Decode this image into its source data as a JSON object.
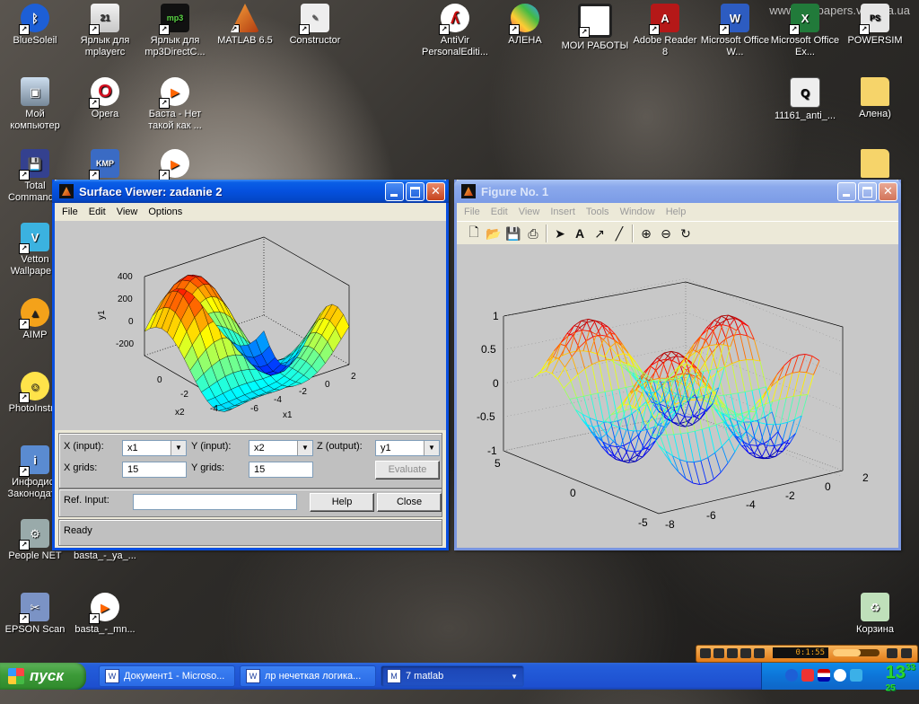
{
  "watermark": "www.wallpapers.vaseha.ua",
  "desktop_icons": [
    {
      "label": "BlueSoleil",
      "sym": "ᛒ"
    },
    {
      "label": "Ярлык для mplayerc",
      "sym": "21"
    },
    {
      "label": "Ярлык для mp3DirectC...",
      "sym": "mp3"
    },
    {
      "label": "MATLAB 6.5",
      "sym": ""
    },
    {
      "label": "Constructor",
      "sym": "✎"
    },
    {
      "label": "AntiVir PersonalEditi...",
      "sym": "ʎ"
    },
    {
      "label": "АЛЕНА",
      "sym": ""
    },
    {
      "label": "МОИ РАБОТЫ",
      "sym": ""
    },
    {
      "label": "Adobe Reader 8",
      "sym": "A"
    },
    {
      "label": "Microsoft Office W...",
      "sym": "W"
    },
    {
      "label": "Microsoft Office Ex...",
      "sym": "X"
    },
    {
      "label": "POWERSIM",
      "sym": "PS"
    },
    {
      "label": "Мой компьютер",
      "sym": "▣"
    },
    {
      "label": "Opera",
      "sym": "O"
    },
    {
      "label": "Баста - Нет такой как ...",
      "sym": "▶"
    },
    {
      "label": "11161_anti_...",
      "sym": "Q"
    },
    {
      "label": "Алена)",
      "sym": ""
    },
    {
      "label": "Total Command...",
      "sym": "💾"
    },
    {
      "label": "",
      "sym": "KMP"
    },
    {
      "label": "",
      "sym": "▶"
    },
    {
      "label": "",
      "sym": ""
    },
    {
      "label": "Vetton Wallpape...",
      "sym": "V"
    },
    {
      "label": "AIMP",
      "sym": "▲"
    },
    {
      "label": "PhotoInstr...",
      "sym": "☺"
    },
    {
      "label": "Инфодиск Законодат...",
      "sym": "i"
    },
    {
      "label": "People NET",
      "sym": "⚙"
    },
    {
      "label": "basta_-_ya_...",
      "sym": "▶"
    },
    {
      "label": "EPSON Scan",
      "sym": "✂"
    },
    {
      "label": "basta_-_mn...",
      "sym": "▶"
    },
    {
      "label": "Корзина",
      "sym": "♻"
    }
  ],
  "surface_viewer": {
    "title": "Surface Viewer: zadanie 2",
    "menu": [
      "File",
      "Edit",
      "View",
      "Options"
    ],
    "plot": {
      "z_ticks": [
        "400",
        "200",
        "0",
        "-200"
      ],
      "z_label": "y1",
      "x1_ticks": [
        "-6",
        "-4",
        "-2",
        "0",
        "2"
      ],
      "x1_label": "x1",
      "x2_ticks": [
        "0",
        "-2",
        "-4"
      ],
      "x2_label": "x2"
    },
    "x_input_label": "X (input):",
    "x_input_value": "x1",
    "y_input_label": "Y (input):",
    "y_input_value": "x2",
    "z_output_label": "Z (output):",
    "z_output_value": "y1",
    "x_grids_label": "X grids:",
    "x_grids_value": "15",
    "y_grids_label": "Y grids:",
    "y_grids_value": "15",
    "evaluate_label": "Evaluate",
    "ref_input_label": "Ref. Input:",
    "ref_input_value": "",
    "help_label": "Help",
    "close_label": "Close",
    "status": "Ready"
  },
  "figure": {
    "title": "Figure No. 1",
    "menu": [
      "File",
      "Edit",
      "View",
      "Insert",
      "Tools",
      "Window",
      "Help"
    ],
    "toolbar": [
      "new-icon",
      "open-icon",
      "save-icon",
      "print-icon",
      "arrow-icon",
      "text-icon",
      "arrow-line-icon",
      "line-icon",
      "zoom-in-icon",
      "zoom-out-icon",
      "rotate-icon"
    ],
    "plot": {
      "z_ticks": [
        "1",
        "0.5",
        "0",
        "-0.5",
        "-1"
      ],
      "y_ticks": [
        "5",
        "0",
        "-5"
      ],
      "x_ticks": [
        "-8",
        "-6",
        "-4",
        "-2",
        "0",
        "2"
      ]
    }
  },
  "taskbar": {
    "start_label": "пуск",
    "items": [
      {
        "label": "Документ1 - Microso...",
        "icon": "W"
      },
      {
        "label": "лр нечеткая логика...",
        "icon": "W"
      },
      {
        "label": "7 matlab",
        "icon": "M"
      }
    ],
    "lang": "EN",
    "clock_main": "13",
    "clock_minutes": "33",
    "clock_seconds": "25"
  },
  "player": {
    "time": "0:1:55",
    "volume_fraction": 0.6
  },
  "colors": {
    "xp_blue": "#0550de",
    "start_green": "#3c9a38",
    "window_face": "#ece9d8",
    "plot_bg": "#c8c8c8"
  }
}
